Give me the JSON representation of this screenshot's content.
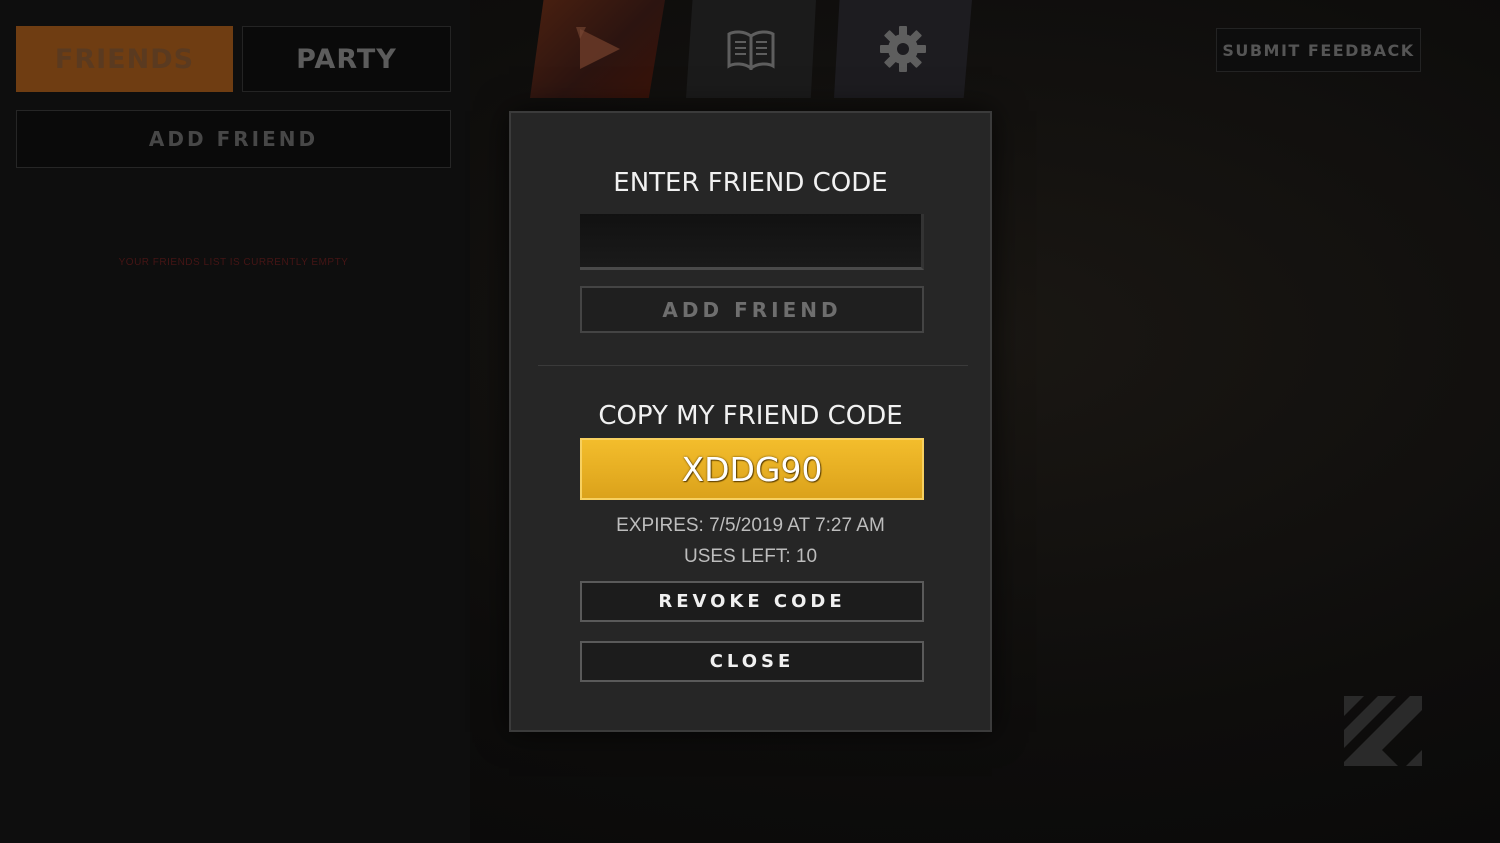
{
  "social": {
    "tabs": [
      {
        "label": "FRIENDS",
        "active": true
      },
      {
        "label": "PARTY",
        "active": false
      }
    ],
    "add_friend_label": "ADD FRIEND",
    "empty_message": "YOUR FRIENDS LIST IS CURRENTLY EMPTY"
  },
  "nav": {
    "items": [
      {
        "name": "play",
        "icon": "play-icon"
      },
      {
        "name": "library",
        "icon": "book-icon"
      },
      {
        "name": "settings",
        "icon": "gear-icon"
      }
    ]
  },
  "feedback": {
    "label": "SUBMIT FEEDBACK"
  },
  "modal": {
    "enter_heading": "ENTER FRIEND CODE",
    "input_value": "",
    "add_friend_label": "ADD FRIEND",
    "copy_heading": "COPY MY FRIEND CODE",
    "friend_code": "XDDG90",
    "expires": "EXPIRES: 7/5/2019 AT 7:27 AM",
    "uses_left": "USES LEFT: 10",
    "revoke_label": "REVOKE CODE",
    "close_label": "CLOSE"
  },
  "colors": {
    "accent_gold": "#e8ae22",
    "friends_tab": "#6f3d12",
    "modal_bg": "#262626"
  },
  "brand": {
    "icon": "studio-logo-icon"
  }
}
